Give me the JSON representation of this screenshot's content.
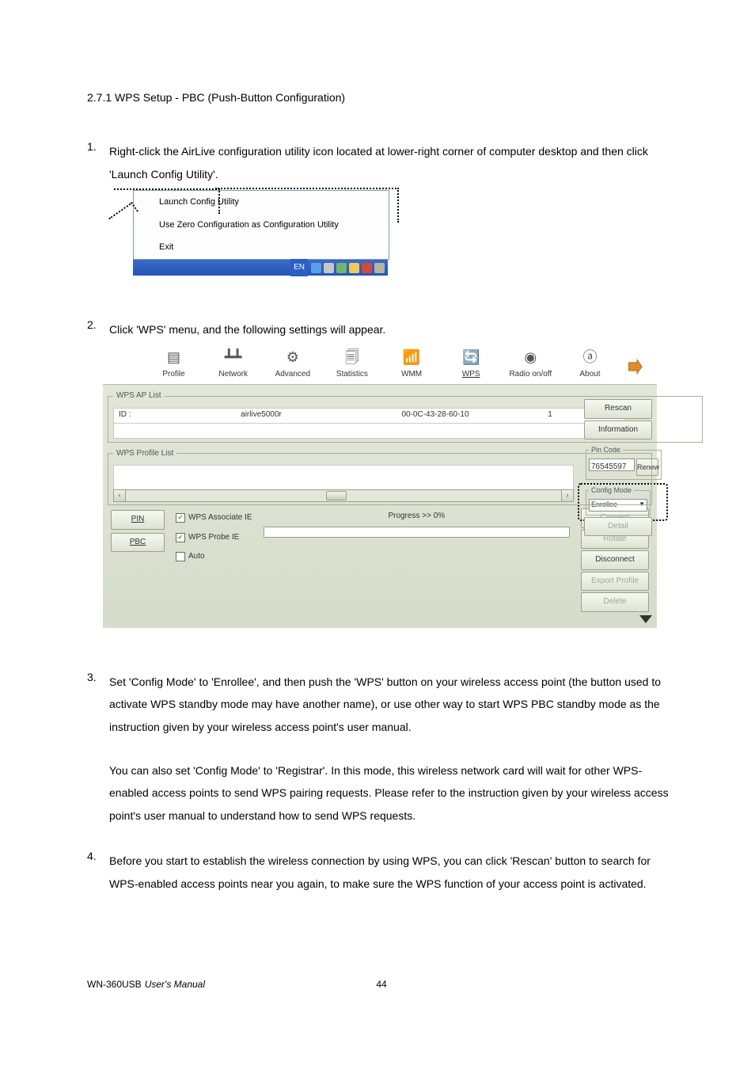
{
  "heading": "2.7.1 WPS Setup - PBC (Push-Button Configuration)",
  "steps": {
    "s1": {
      "num": "1.",
      "text": "Right-click the AirLive configuration utility icon located at lower-right corner of computer desktop and then click 'Launch Config Utility'."
    },
    "s2": {
      "num": "2.",
      "text": "Click 'WPS' menu, and the following settings will appear."
    },
    "s3": {
      "num": "3.",
      "p1": "Set 'Config Mode' to 'Enrollee', and then push the 'WPS' button on your wireless access point (the button used to activate WPS standby mode may have another name), or use other way to start WPS PBC standby mode as the instruction given by your wireless access point's user manual.",
      "p2": "You can also set 'Config Mode' to 'Registrar'. In this mode, this wireless network card will wait for other WPS-enabled access points to send WPS pairing requests. Please refer to the instruction given by your wireless access point's user manual to understand how to send WPS requests."
    },
    "s4": {
      "num": "4.",
      "text": "Before you start to establish the wireless connection by using WPS, you can click 'Rescan' button to search for WPS-enabled access points near you again, to make sure the WPS function of your access point is activated."
    }
  },
  "sshot1": {
    "menu": {
      "launch": "Launch Config Utility",
      "usezero": "Use Zero Configuration as Configuration Utility",
      "exit": "Exit"
    },
    "lang": "EN"
  },
  "sshot2": {
    "tabs": {
      "profile": "Profile",
      "network": "Network",
      "advanced": "Advanced",
      "statistics": "Statistics",
      "wmm": "WMM",
      "wps": "WPS",
      "radio": "Radio on/off",
      "about": "About"
    },
    "aplist": {
      "legend": "WPS AP List",
      "row": {
        "id_label": "ID :",
        "ssid": "airlive5000r",
        "mac": "00-0C-43-28-60-10",
        "ch": "1"
      }
    },
    "profilelist": {
      "legend": "WPS Profile List"
    },
    "side": {
      "rescan": "Rescan",
      "info": "Information",
      "pincode_legend": "Pin Code",
      "pincode_value": "76545597",
      "renew": "Renew",
      "config_legend": "Config Mode",
      "config_value": "Enrollee",
      "detail": "Detail"
    },
    "bottom": {
      "pin": "PIN",
      "pbc": "PBC",
      "assoc": "WPS Associate IE",
      "probe": "WPS Probe IE",
      "auto": "Auto",
      "progress": "Progress >> 0%",
      "connect": "Connect",
      "rotate": "Rotate",
      "disconnect": "Disconnect",
      "export": "Export Profile",
      "delete": "Delete"
    }
  },
  "footer": {
    "model": "WN-360USB",
    "manual": "User's Manual",
    "page": "44"
  }
}
